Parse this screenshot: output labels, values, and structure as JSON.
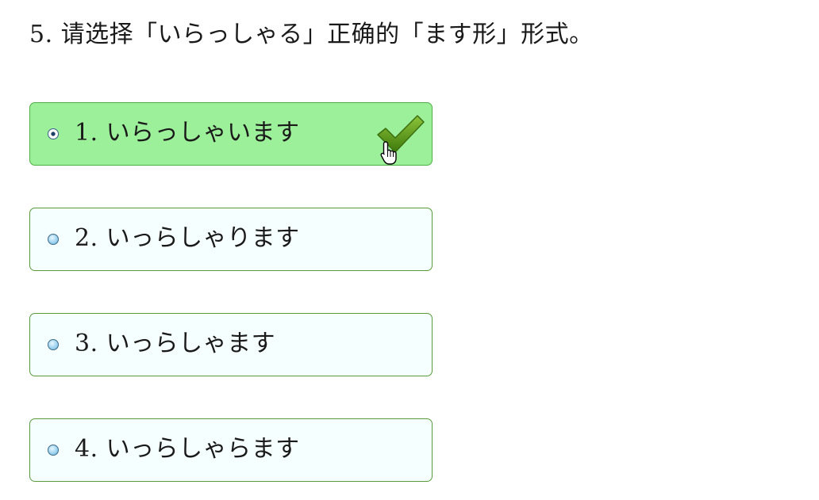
{
  "question": {
    "text": "5. 请选择「いらっしゃる」正确的「ます形」形式。"
  },
  "options": [
    {
      "label": "1. いらっしゃいます",
      "selected": true,
      "correct": true
    },
    {
      "label": "2. いっらしゃります",
      "selected": false
    },
    {
      "label": "3. いっらしゃます",
      "selected": false
    },
    {
      "label": "4. いっらしゃらます",
      "selected": false
    }
  ],
  "colors": {
    "selected_bg": "#9df09a",
    "option_bg": "#f6ffff",
    "border": "#5a9a3a",
    "check": "#5e9e14"
  },
  "icons": {
    "check": "checkmark-icon",
    "cursor": "hand-pointer-cursor",
    "radio": "radio-button"
  }
}
